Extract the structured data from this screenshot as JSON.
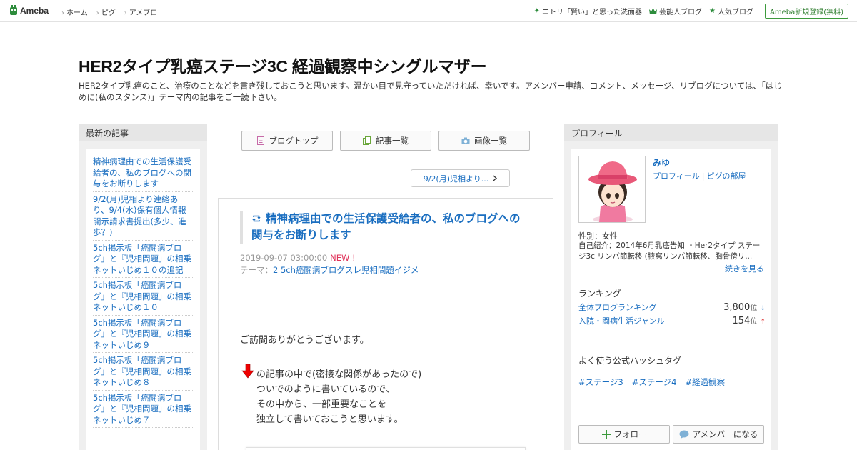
{
  "topbar": {
    "logo_text": "Ameba",
    "nav": [
      "ホーム",
      "ピグ",
      "アメブロ"
    ],
    "right_links": [
      {
        "icon": "sparkle-icon",
        "label": "ニトリ「賢い」と思った洗面器"
      },
      {
        "icon": "crown-icon",
        "label": "芸能人ブログ"
      },
      {
        "icon": "star-icon",
        "label": "人気ブログ"
      }
    ],
    "register_label": "Ameba新規登録(無料)"
  },
  "blog": {
    "title": "HER2タイプ乳癌ステージ3C 経過観察中シングルマザー",
    "description": "HER2タイプ乳癌のこと、治療のことなどを書き残しておこうと思います。温かい目で見守っていただければ、幸いです。アメンバー申請、コメント、メッセージ、リブログについては、「はじめに(私のスタンス)」テーマ内の記事をご一読下さい。"
  },
  "left_sidebar": {
    "heading": "最新の記事",
    "items": [
      "精神病理由での生活保護受給者の、私のブログへの関与をお断りします",
      "9/2(月)児相より連絡あり、9/4(水)保有個人情報開示請求書提出(多少、進歩？)",
      "5ch掲示板「癌闘病ブログ」と『児相問題」の相乗ネットいじめ１０の追記",
      "5ch掲示板「癌闘病ブログ」と『児相問題」の相乗ネットいじめ１０",
      "5ch掲示板「癌闘病ブログ」と『児相問題」の相乗ネットいじめ９",
      "5ch掲示板「癌闘病ブログ」と『児相問題」の相乗ネットいじめ８",
      "5ch掲示板「癌闘病ブログ」と『児相問題」の相乗ネットいじめ７"
    ]
  },
  "main": {
    "nav_buttons": [
      {
        "icon": "document-icon",
        "label": "ブログトップ"
      },
      {
        "icon": "copy-icon",
        "label": "記事一覧"
      },
      {
        "icon": "camera-icon",
        "label": "画像一覧"
      }
    ],
    "next_label": "9/2(月)児相より...",
    "article": {
      "title": "精神病理由での生活保護受給者の、私のブログへの関与をお断りします",
      "date": "2019-09-07 03:00:00",
      "new_badge": "NEW !",
      "theme_prefix": "テーマ：",
      "theme": "2 5ch癌闘病ブログスレ児相問題イジメ",
      "body": [
        "ご訪問ありがとうございます。",
        "の記事の中で(密接な関係があったので)",
        "ついでのように書いているので、",
        "その中から、一部重要なことを",
        "独立して書いておこうと思います。"
      ]
    }
  },
  "right_sidebar": {
    "heading": "プロフィール",
    "name": "みゆ",
    "link_profile": "プロフィール",
    "link_room": "ピグの部屋",
    "link_sep": "|",
    "gender": "性別：女性",
    "intro": "自己紹介：2014年6月乳癌告知 ・Her2タイプ ステージ3c リンパ節転移 (腋窩リンパ節転移、胸骨傍リ...",
    "more": "続きを見る",
    "ranking_title": "ランキング",
    "rankings": [
      {
        "label": "全体ブログランキング",
        "value": "3,800",
        "unit": "位",
        "trend": "↓"
      },
      {
        "label": "入院・闘病生活ジャンル",
        "value": "154",
        "unit": "位",
        "trend": "↑"
      }
    ],
    "hashtag_title": "よく使う公式ハッシュタグ",
    "hashtags": [
      "#ステージ3",
      "#ステージ4",
      "#経過観察"
    ],
    "follow_label": "フォロー",
    "amember_label": "アメンバーになる"
  },
  "colors": {
    "link": "#1a6ec0",
    "ameba_green": "#2d8c3c",
    "new": "#e0335a"
  }
}
